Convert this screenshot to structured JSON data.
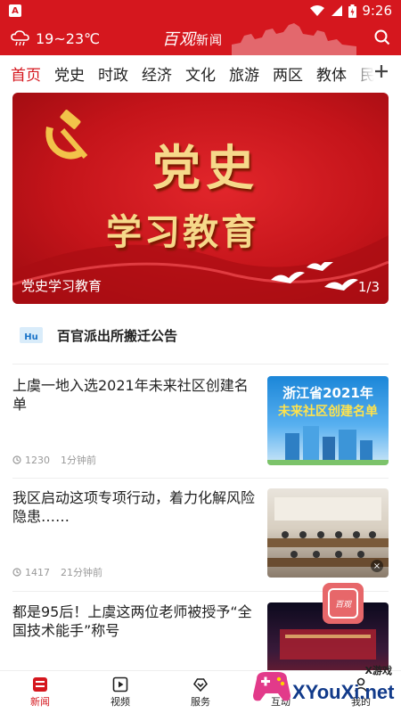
{
  "status_bar": {
    "time": "9:26",
    "app_icon_letter": "A",
    "icons": [
      "wifi-icon",
      "signal-icon",
      "battery-icon"
    ]
  },
  "header": {
    "weather": "19~23℃",
    "logo_script": "百观",
    "logo_suffix": "新闻",
    "accent_color": "#d5171e"
  },
  "tabs": [
    "首页",
    "党史",
    "时政",
    "经济",
    "文化",
    "旅游",
    "两区",
    "教体",
    "民"
  ],
  "active_tab": 0,
  "banner": {
    "title_line1": "党史",
    "title_line2": "学习教育",
    "caption": "党史学习教育",
    "pager": "1/3"
  },
  "notice": {
    "text": "百官派出所搬迁公告"
  },
  "articles": [
    {
      "title": "上虞一地入选2021年未来社区创建名单",
      "views": "1230",
      "time_ago": "1分钟前",
      "thumb_line1": "浙江省2021年",
      "thumb_line2": "未来社区创建名单"
    },
    {
      "title": "我区启动这项专项行动，着力化解风险隐患……",
      "views": "1417",
      "time_ago": "21分钟前",
      "thumb_close": "×"
    },
    {
      "title": "都是95后！上虞这两位老师被授予“全国技术能手”称号"
    }
  ],
  "bottom_nav": [
    "新闻",
    "视频",
    "服务",
    "互动",
    "我的"
  ],
  "float_badge": "百观",
  "watermark": {
    "top": "X游戏",
    "main": "XYouXi.net"
  }
}
